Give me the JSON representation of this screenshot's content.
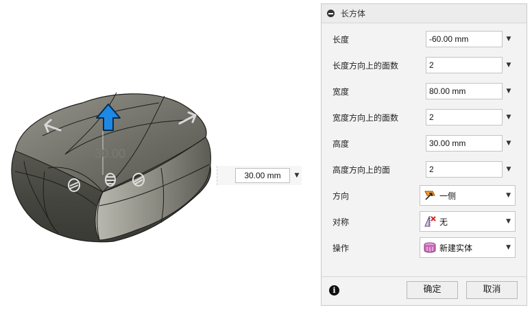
{
  "viewport": {
    "dimension_label": "30.00",
    "height_input": {
      "value": "30.00 mm"
    }
  },
  "dialog": {
    "title": "长方体",
    "rows": [
      {
        "label": "长度",
        "value": "-60.00 mm"
      },
      {
        "label": "长度方向上的面数",
        "value": "2"
      },
      {
        "label": "宽度",
        "value": "80.00 mm"
      },
      {
        "label": "宽度方向上的面数",
        "value": "2"
      },
      {
        "label": "高度",
        "value": "30.00 mm"
      },
      {
        "label": "高度方向上的面",
        "value": "2"
      }
    ],
    "direction": {
      "label": "方向",
      "value": "一侧",
      "icon": "one-side-direction-icon"
    },
    "symmetry": {
      "label": "对称",
      "value": "无",
      "icon": "no-symmetry-icon"
    },
    "operation": {
      "label": "操作",
      "value": "新建实体",
      "icon": "new-body-icon"
    },
    "buttons": {
      "ok": "确定",
      "cancel": "取消"
    }
  },
  "colors": {
    "arrow_blue": "#1e88e5",
    "body_dark": "#4a4a44",
    "body_light": "#8a8a80",
    "dialog_bg": "#f3f3f3"
  }
}
